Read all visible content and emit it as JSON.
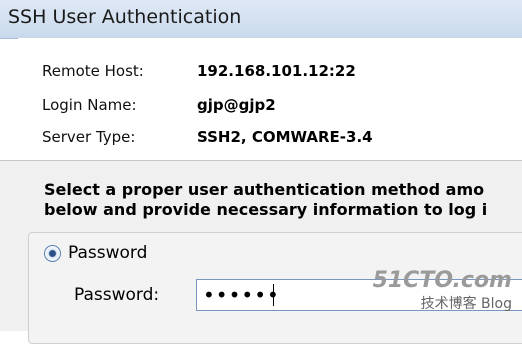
{
  "window": {
    "title": "SSH User Authentication"
  },
  "info": {
    "remote_host_label": "Remote Host:",
    "remote_host_value": "192.168.101.12:22",
    "login_name_label": "Login Name:",
    "login_name_value": "gjp@gjp2",
    "server_type_label": "Server Type:",
    "server_type_value": "SSH2, COMWARE-3.4"
  },
  "instructions": {
    "line1": "Select a proper user authentication method amo",
    "line2": "below and provide necessary information to log i"
  },
  "auth": {
    "password_option_label": "Password",
    "password_selected": true,
    "password_field_label": "Password:",
    "password_value": "••••••"
  },
  "watermark": {
    "logo": "51CTO.com",
    "tagline": "技术博客 Blog"
  }
}
